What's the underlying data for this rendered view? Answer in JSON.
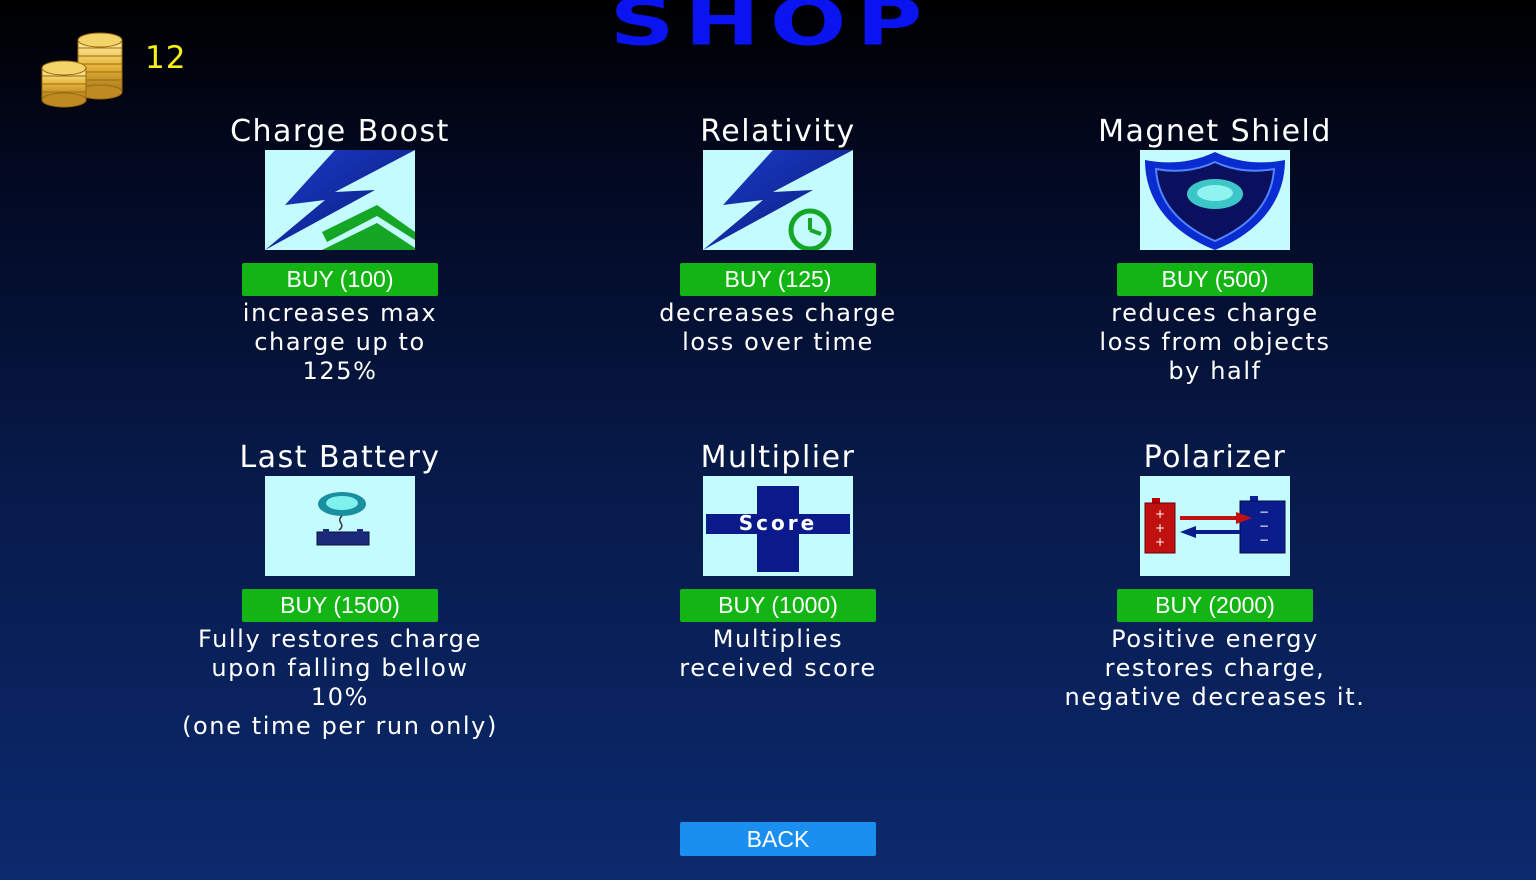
{
  "header": {
    "title": "SHOP",
    "coins": "12",
    "coin_icon": "coin-stack-icon"
  },
  "items": [
    {
      "name": "Charge Boost",
      "icon": "lightning-up-arrow-icon",
      "buy_label": "BUY (100)",
      "description": "increases max\ncharge up to\n125%"
    },
    {
      "name": "Relativity",
      "icon": "lightning-clock-icon",
      "buy_label": "BUY (125)",
      "description": "decreases charge\nloss over time"
    },
    {
      "name": "Magnet Shield",
      "icon": "shield-icon",
      "buy_label": "BUY (500)",
      "description": "reduces charge\nloss from objects\nby half"
    },
    {
      "name": "Last Battery",
      "icon": "battery-orb-icon",
      "buy_label": "BUY (1500)",
      "description": "Fully restores charge\nupon falling bellow\n10%\n(one time per run only)"
    },
    {
      "name": "Multiplier",
      "icon": "score-plus-icon",
      "icon_text": "Score",
      "buy_label": "BUY (1000)",
      "description": "Multiplies\nreceived score"
    },
    {
      "name": "Polarizer",
      "icon": "polarized-batteries-icon",
      "buy_label": "BUY (2000)",
      "description": "Positive energy\nrestores charge,\nnegative decreases it."
    }
  ],
  "footer": {
    "back_label": "BACK"
  },
  "colors": {
    "title": "#0a14f0",
    "coins_text": "#f5f01a",
    "buy_button": "#12b514",
    "back_button": "#1b8ff0",
    "item_image_bg": "#c4fbfe"
  }
}
